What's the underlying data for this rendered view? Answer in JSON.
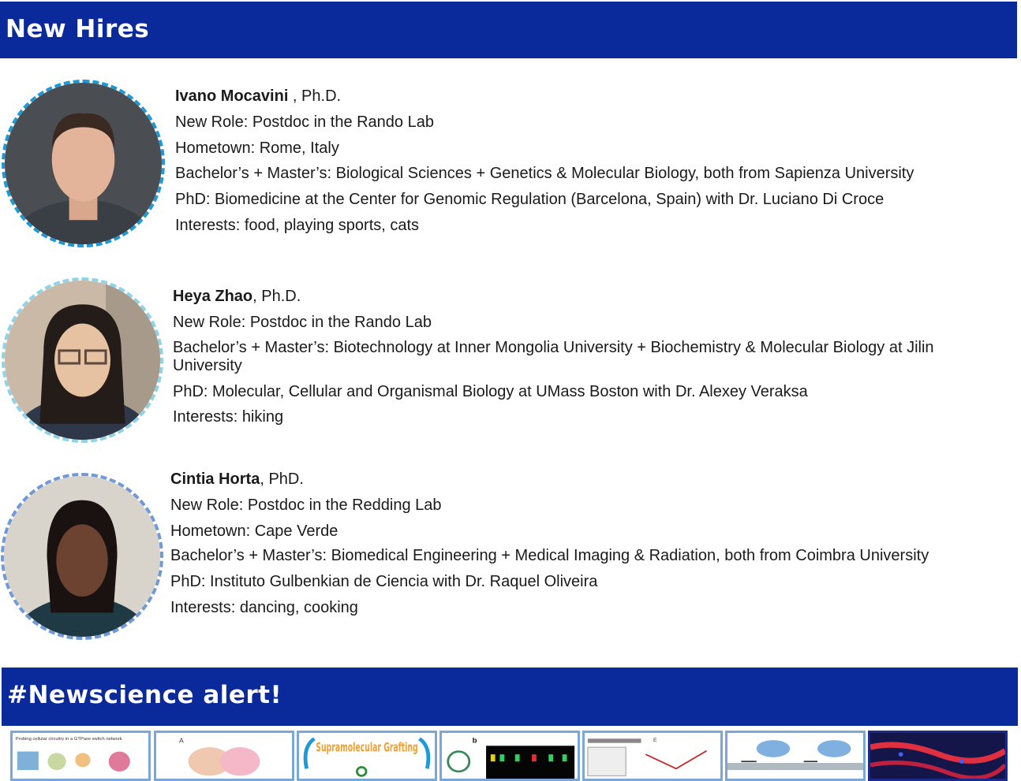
{
  "sections": {
    "new_hires_title": "New Hires",
    "newscience_title": "#Newscience alert!"
  },
  "people": [
    {
      "name": "Ivano Mocavini",
      "suffix": " , Ph.D.",
      "role": "New Role: Postdoc in the Rando Lab",
      "hometown": "Hometown: Rome, Italy",
      "bachelors": "Bachelor’s + Master’s: Biological Sciences + Genetics & Molecular Biology, both from Sapienza University",
      "phd": "PhD: Biomedicine at the Center for Genomic Regulation (Barcelona, Spain) with Dr. Luciano Di Croce",
      "interests": "Interests: food, playing sports, cats"
    },
    {
      "name": "Heya Zhao",
      "suffix": ", Ph.D.",
      "role": "New Role: Postdoc in the Rando Lab",
      "bachelors": "Bachelor’s + Master’s: Biotechnology at Inner Mongolia University + Biochemistry & Molecular Biology at Jilin University",
      "phd": "PhD: Molecular, Cellular and Organismal Biology at UMass Boston with Dr. Alexey Veraksa",
      "interests": "Interests: hiking"
    },
    {
      "name": "Cintia Horta",
      "suffix": ", PhD.",
      "role": "New Role: Postdoc in the Redding Lab",
      "hometown": "Hometown: Cape Verde",
      "bachelors": "Bachelor’s + Master’s: Biomedical Engineering + Medical Imaging & Radiation, both from Coimbra University",
      "phd": "PhD: Instituto Gulbenkian de Ciencia with Dr. Raquel Oliveira",
      "interests": "Interests: dancing, cooking"
    }
  ],
  "thumbnails": [
    {
      "caption": "Probing cellular circuitry in a GTPase switch network"
    },
    {
      "caption": "A"
    },
    {
      "caption": "Supramolecular Grafting"
    },
    {
      "caption": "b"
    },
    {
      "caption": "E"
    },
    {
      "caption": ""
    },
    {
      "caption": ""
    }
  ],
  "colors": {
    "banner": "#0a2a9c",
    "portrait_border_1": "#1f9ad6",
    "portrait_border_2": "#8fd3e8",
    "portrait_border_3": "#6f99d8"
  }
}
